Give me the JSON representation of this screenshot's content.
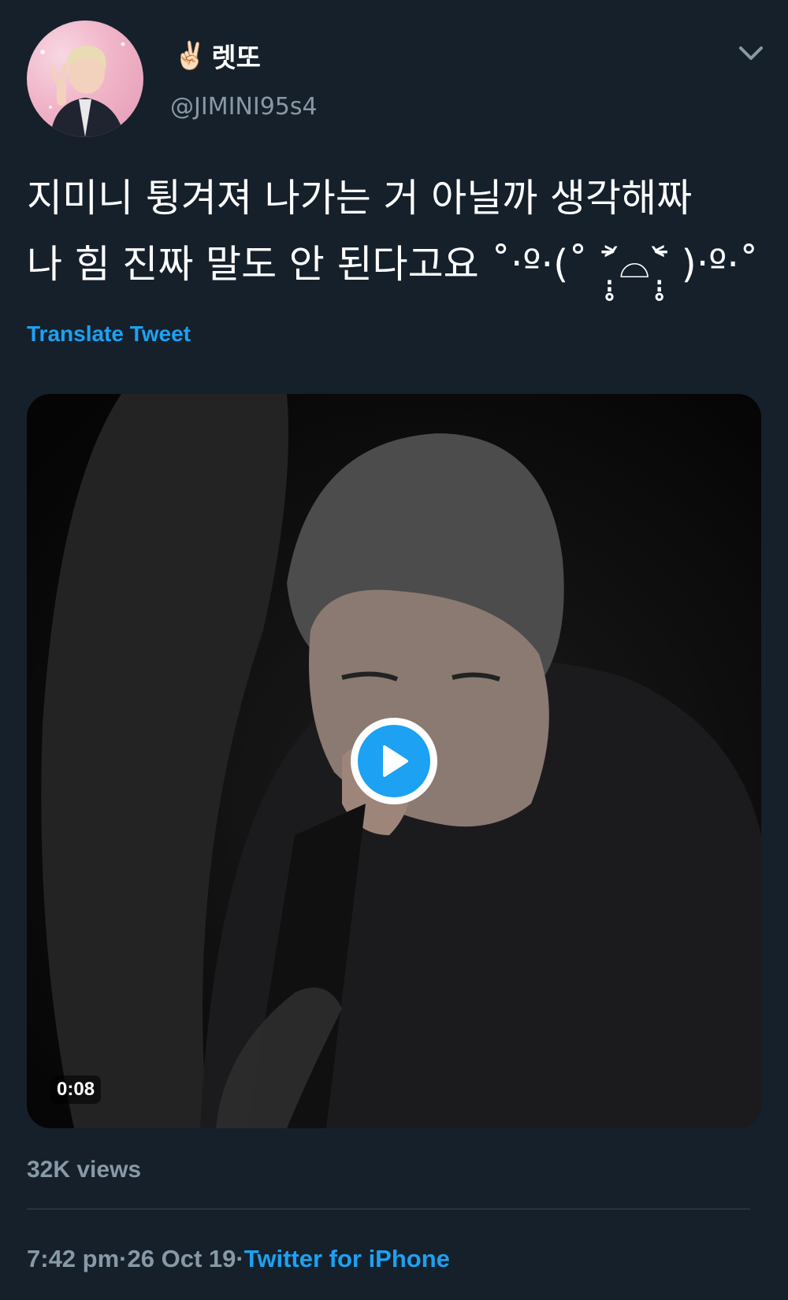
{
  "tweet": {
    "user": {
      "display_emoji": "✌🏻",
      "display_name": "렛또",
      "handle": "@JIMINI95s4"
    },
    "text": "지미니 튕겨져 나가는 거 아닐까 생각해짜\n나 힘 진짜 말도 안 된다고요 ˚‧º·(˚ ˃̣̣̥᷄⌓˂̣̣̥᷅ )‧º·˚",
    "translate_label": "Translate Tweet",
    "media": {
      "duration": "0:08"
    },
    "views": "32K views",
    "time": "7:42 pm",
    "separator": " · ",
    "date": "26 Oct 19",
    "source": "Twitter for iPhone"
  },
  "colors": {
    "background": "#15202b",
    "accent": "#1da1f2",
    "secondary_text": "#8899a6",
    "divider": "#38444d"
  },
  "icons": {
    "more": "chevron-down-icon",
    "play": "play-icon"
  }
}
